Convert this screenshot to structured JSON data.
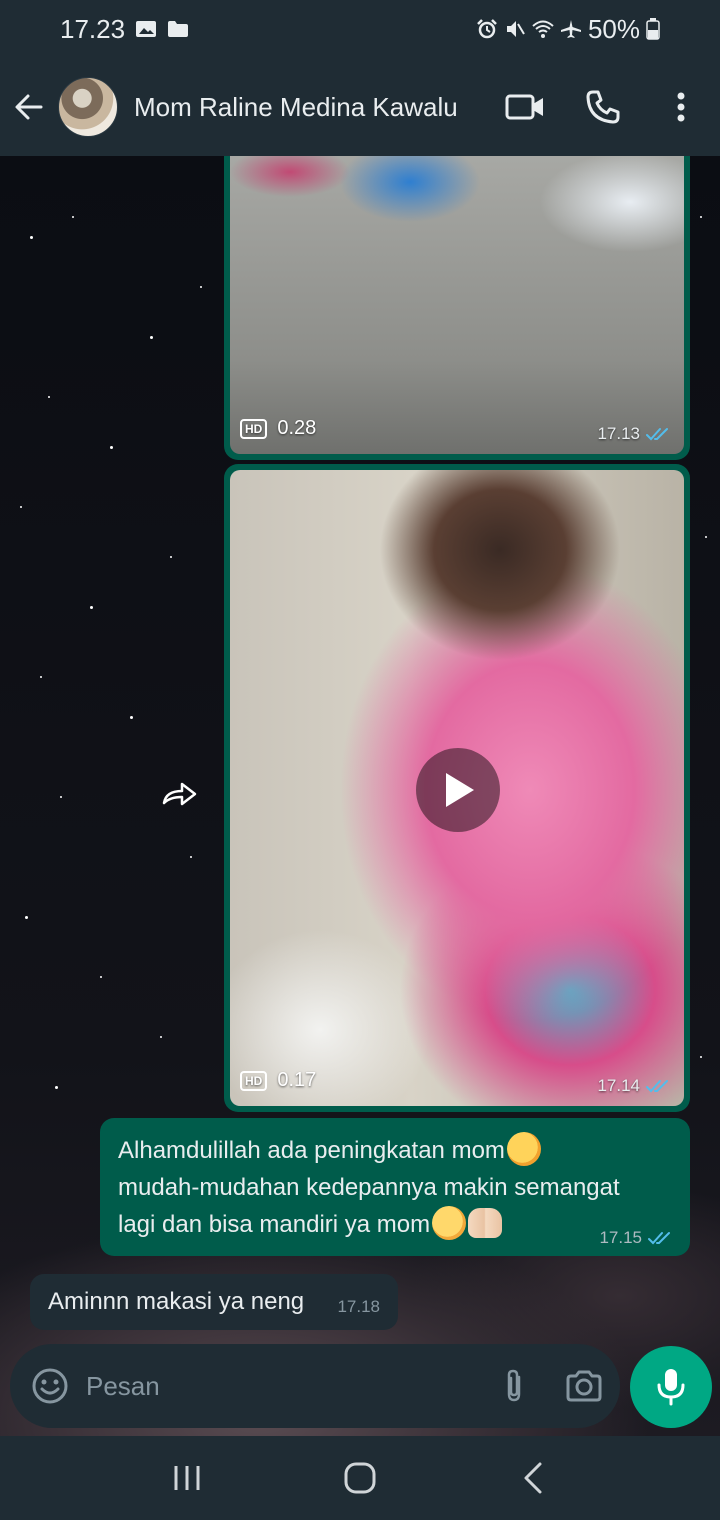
{
  "status_bar": {
    "time": "17.23",
    "battery": "50%",
    "icons": [
      "gallery-icon",
      "folder-icon",
      "alarm-icon",
      "mute-icon",
      "wifi-icon",
      "airplane-icon",
      "battery-icon"
    ]
  },
  "header": {
    "contact_name": "Mom Raline Medina Kawalu",
    "actions": [
      "back-arrow-icon",
      "video-call-icon",
      "phone-icon",
      "more-vert-icon"
    ]
  },
  "messages": [
    {
      "type": "video",
      "direction": "out",
      "quality_badge": "HD",
      "duration": "0.28",
      "time": "17.13",
      "status": "read"
    },
    {
      "type": "video",
      "direction": "out",
      "quality_badge": "HD",
      "duration": "0.17",
      "time": "17.14",
      "status": "read"
    },
    {
      "type": "text",
      "direction": "out",
      "lines": [
        "Alhamdulillah ada peningkatan mom",
        "mudah-mudahan kedepannya makin semangat",
        "lagi dan bisa mandiri ya mom"
      ],
      "time": "17.15",
      "status": "read"
    },
    {
      "type": "text",
      "direction": "in",
      "text": "Aminnn makasi ya neng",
      "time": "17.18"
    }
  ],
  "composer": {
    "placeholder": "Pesan",
    "icons": [
      "emoji-icon",
      "attach-icon",
      "camera-icon",
      "mic-icon"
    ]
  },
  "colors": {
    "outgoing_bubble": "#005c4b",
    "incoming_bubble": "#1f2c34",
    "header_bg": "#1f2c34",
    "accent": "#00a884",
    "read_ticks": "#53bdeb"
  }
}
